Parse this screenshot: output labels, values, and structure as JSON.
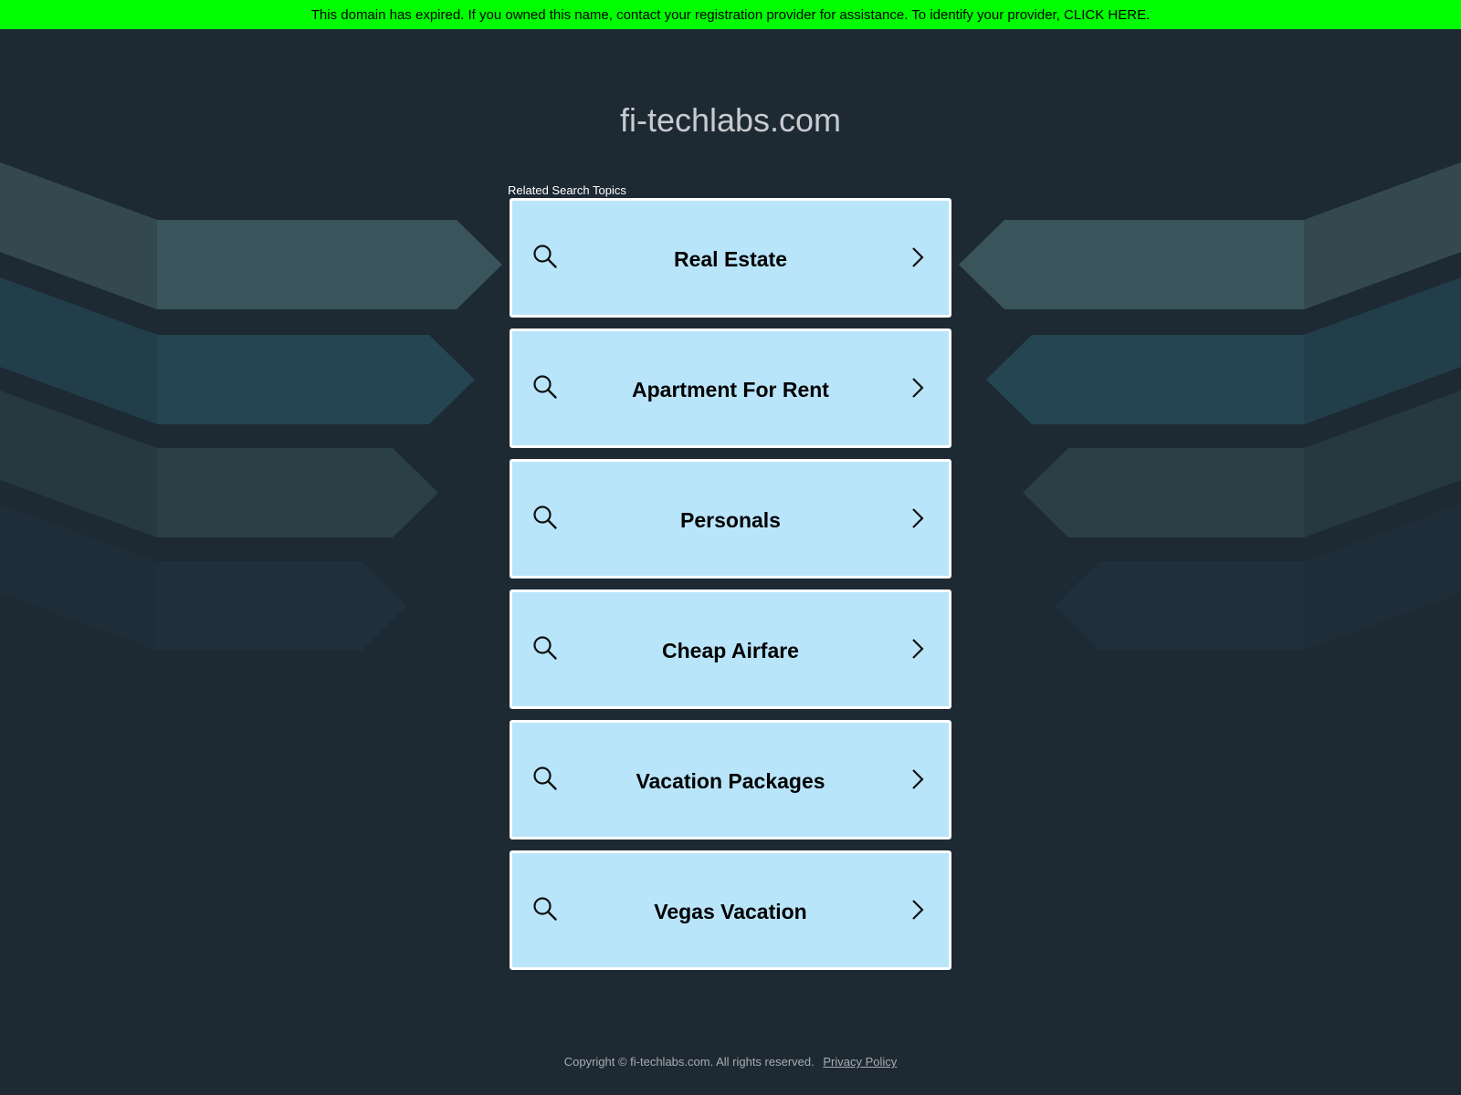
{
  "banner": {
    "text": "This domain has expired. If you owned this name, contact your registration provider for assistance. To identify your provider, CLICK HERE."
  },
  "domain_title": "fi-techlabs.com",
  "topics_label": "Related Search Topics",
  "topics": [
    {
      "label": "Real Estate",
      "icon": "search-icon",
      "arrow": "chevron-right-icon"
    },
    {
      "label": "Apartment For Rent",
      "icon": "search-icon",
      "arrow": "chevron-right-icon"
    },
    {
      "label": "Personals",
      "icon": "search-icon",
      "arrow": "chevron-right-icon"
    },
    {
      "label": "Cheap Airfare",
      "icon": "search-icon",
      "arrow": "chevron-right-icon"
    },
    {
      "label": "Vacation Packages",
      "icon": "search-icon",
      "arrow": "chevron-right-icon"
    },
    {
      "label": "Vegas Vacation",
      "icon": "search-icon",
      "arrow": "chevron-right-icon"
    }
  ],
  "footer": {
    "copyright": "Copyright © fi-techlabs.com.  All rights reserved.",
    "privacy_link": "Privacy Policy"
  },
  "colors": {
    "background": "#1d2933",
    "banner": "#00ff00",
    "topic_fill": "#b9e5fa",
    "topic_border": "#ffffff",
    "title_text": "#c7cbd0"
  }
}
